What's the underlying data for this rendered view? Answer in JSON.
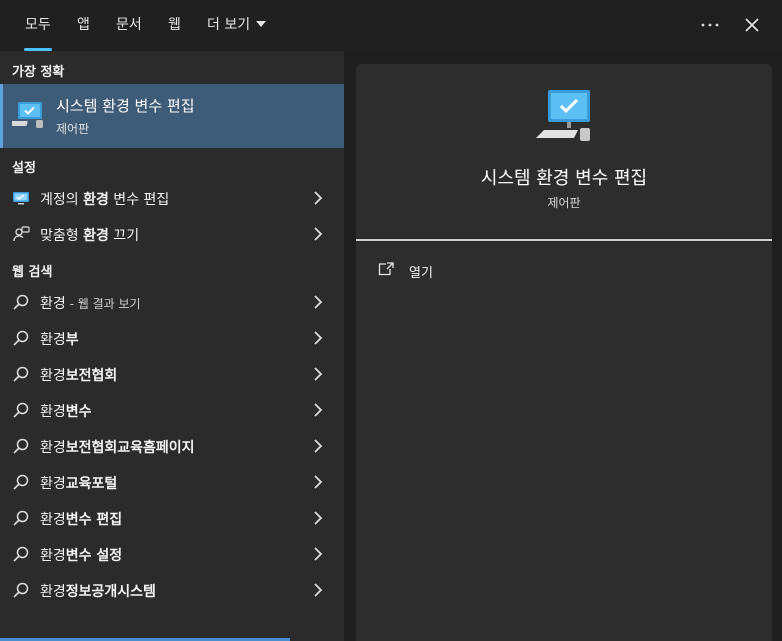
{
  "tabs": [
    {
      "label": "모두"
    },
    {
      "label": "앱"
    },
    {
      "label": "문서"
    },
    {
      "label": "웹"
    },
    {
      "label": "더 보기"
    }
  ],
  "icons": {
    "more": "more-options-icon",
    "close": "close-icon",
    "app": "monitor-checkmark-icon",
    "search": "search-icon",
    "chevron": "chevron-right-icon",
    "open": "open-external-icon"
  },
  "colors": {
    "accent": "#4cc2ff",
    "selected": "#3e5b77"
  },
  "sections": {
    "best": "가장 정확",
    "settings": "설정",
    "web": "웹 검색"
  },
  "best_match": {
    "title": "시스템 환경 변수 편집",
    "subtitle": "제어판"
  },
  "settings_items": [
    {
      "pre": "계정의 ",
      "bold": "환경",
      "post": " 변수 편집"
    },
    {
      "pre": "맞춤형 ",
      "bold": "환경",
      "post": " 끄기"
    }
  ],
  "web_first": {
    "main": "환경",
    "suffix": " - 웹 결과 보기"
  },
  "web_items": [
    {
      "pre": "환경",
      "bold": "부"
    },
    {
      "pre": "환경",
      "bold": "보전협회"
    },
    {
      "pre": "환경",
      "bold": "변수"
    },
    {
      "pre": "환경",
      "bold": "보전협회교육홈페이지"
    },
    {
      "pre": "환경",
      "bold": "교육포털"
    },
    {
      "pre": "환경",
      "bold": "변수 편집"
    },
    {
      "pre": "환경",
      "bold": "변수 설정"
    },
    {
      "pre": "환경",
      "bold": "정보공개시스템"
    }
  ],
  "preview": {
    "title": "시스템 환경 변수 편집",
    "subtitle": "제어판",
    "open_label": "열기"
  }
}
